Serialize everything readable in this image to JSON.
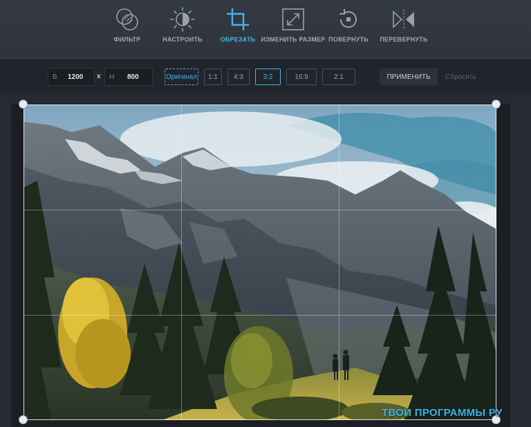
{
  "toolbar": {
    "tools": [
      {
        "label": "ФИЛЬТР",
        "icon": "filter-icon"
      },
      {
        "label": "НАСТРОИТЬ",
        "icon": "adjust-icon"
      },
      {
        "label": "ОБРЕЗАТЬ",
        "icon": "crop-icon",
        "active": true
      },
      {
        "label": "ИЗМЕНИТЬ РАЗМЕР",
        "icon": "resize-icon"
      },
      {
        "label": "ПОВЕРНУТЬ",
        "icon": "rotate-icon"
      },
      {
        "label": "ПЕРЕВЕРНУТЬ",
        "icon": "flip-icon"
      }
    ]
  },
  "options": {
    "width_key": "В",
    "width_value": "1200",
    "times": "x",
    "height_key": "H",
    "height_value": "800",
    "ratios": [
      "Оригинал",
      "1:1",
      "4:3",
      "3:2",
      "16:9",
      "2:1"
    ],
    "active_ratio": "3:2",
    "apply_label": "ПРИМЕНИТЬ",
    "reset_label": "Сбросить"
  },
  "colors": {
    "accent": "#41b6e6",
    "toolbar_bg": "#343a44",
    "options_bg": "#21252b",
    "canvas_bg": "#262b33"
  },
  "watermark": "ТВОИ ПРОГРАММЫ РУ"
}
